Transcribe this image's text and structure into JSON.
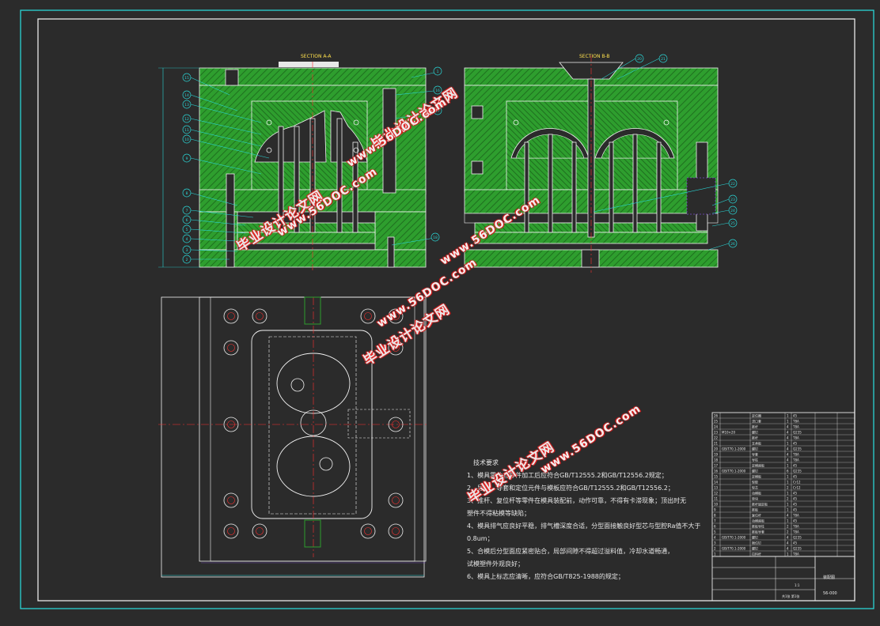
{
  "drawing": {
    "colors": {
      "background": "#2b2b2b",
      "border": "#2ad4d4",
      "green": "#2e9e2e",
      "mold_outline": "#f2f2f2",
      "section_label": "#ffe14d",
      "cyan_leader": "#2ad4d4",
      "centerline": "#ff3030",
      "watermark_red": "#e02020"
    },
    "section_a_label": "SECTION A-A",
    "section_b_label": "SECTION B-B",
    "balloons_a": [
      "15",
      "14",
      "13",
      "12",
      "11",
      "10",
      "9",
      "8",
      "7",
      "6",
      "5",
      "4",
      "3",
      "2",
      "1",
      "16",
      "17",
      "18",
      "19"
    ],
    "balloons_b": [
      "20",
      "21",
      "22",
      "23",
      "24",
      "25",
      "26"
    ]
  },
  "tech_requirements": {
    "title": "技术要求",
    "items": [
      "1、模具零件各零件加工后应符合GB/T12555.2和GB/T12556.2规定；",
      "2、导柱、导套和定位元件与模板应符合GB/T12555.2和GB/T12556.2；",
      "3、推杆、复位杆等零件在模具装配前，动作可靠，不得有卡滞现象；顶出时无",
      "    塑件不得粘模等缺陷；",
      "4、模具排气应良好平稳，排气槽深度合适，分型面接触良好型芯与型腔Ra值不大于",
      "    0.8um；",
      "5、合模后分型面应紧密贴合，局部间隙不得超过溢料值，冷却水道畅通，",
      "    试模塑件外观良好；",
      "6、模具上标志应清晰，应符合GB/T825-1988的规定；"
    ]
  },
  "watermarks": [
    {
      "text": "毕业设计论文网",
      "style": "a"
    },
    {
      "text": "www.56DOC.com",
      "style": "b"
    },
    {
      "text": "毕业设计论文网",
      "style": "a"
    },
    {
      "text": "www.56DOC.com",
      "style": "b"
    },
    {
      "text": "毕业设计论文网",
      "style": "a"
    },
    {
      "text": "www.56DOC.com",
      "style": "b"
    },
    {
      "text": "www.56DOC.com",
      "style": "b"
    },
    {
      "text": "毕业设计论文网",
      "style": "a"
    },
    {
      "text": "www.56DOC.com",
      "style": "b"
    }
  ],
  "title_block": {
    "drawing_no": "56-000",
    "drawing_name": "装配图",
    "scale": "1:1",
    "sheet": "共1张 第1张"
  },
  "bom_rows": [
    {
      "no": "26",
      "name": "定位圈",
      "qty": "1",
      "material": "45"
    },
    {
      "no": "25",
      "name": "浇口套",
      "qty": "1",
      "material": "T8A"
    },
    {
      "no": "24",
      "name": "推杆",
      "qty": "4",
      "material": "T8A"
    },
    {
      "no": "23",
      "name": "M10×20",
      "name2": "螺钉",
      "qty": "4",
      "material": "Q235"
    },
    {
      "no": "22",
      "name": "推杆",
      "qty": "4",
      "material": "T8A"
    },
    {
      "no": "21",
      "name": "支承板",
      "qty": "1",
      "material": "45"
    },
    {
      "no": "20",
      "name": "GB/T70.1-2000",
      "name2": "螺钉",
      "qty": "4",
      "material": "Q235"
    },
    {
      "no": "19",
      "name": "导套",
      "qty": "4",
      "material": "T8A"
    },
    {
      "no": "18",
      "name": "导柱",
      "qty": "4",
      "material": "T8A"
    },
    {
      "no": "17",
      "name": "定模座板",
      "qty": "1",
      "material": "45"
    },
    {
      "no": "16",
      "name": "GB/T70.1-2000",
      "name2": "螺钉",
      "qty": "6",
      "material": "Q235"
    },
    {
      "no": "15",
      "name": "定模板",
      "qty": "1",
      "material": "45"
    },
    {
      "no": "14",
      "name": "型腔",
      "qty": "1",
      "material": "Cr12"
    },
    {
      "no": "13",
      "name": "型芯",
      "qty": "2",
      "material": "Cr12"
    },
    {
      "no": "12",
      "name": "动模板",
      "qty": "1",
      "material": "45"
    },
    {
      "no": "11",
      "name": "垫块",
      "qty": "2",
      "material": "45"
    },
    {
      "no": "10",
      "name": "推杆固定板",
      "qty": "1",
      "material": "45"
    },
    {
      "no": "9",
      "name": "推板",
      "qty": "1",
      "material": "45"
    },
    {
      "no": "8",
      "name": "复位杆",
      "qty": "4",
      "material": "T8A"
    },
    {
      "no": "7",
      "name": "动模座板",
      "qty": "1",
      "material": "45"
    },
    {
      "no": "6",
      "name": "推板导柱",
      "qty": "2",
      "material": "T8A"
    },
    {
      "no": "5",
      "name": "推板导套",
      "qty": "2",
      "material": "T8A"
    },
    {
      "no": "4",
      "name": "GB/T70.1-2000",
      "name2": "螺钉",
      "qty": "4",
      "material": "Q235"
    },
    {
      "no": "3",
      "name": "限位钉",
      "qty": "4",
      "material": "45"
    },
    {
      "no": "2",
      "name": "GB/T70.1-2000",
      "name2": "螺钉",
      "qty": "4",
      "material": "Q235"
    },
    {
      "no": "1",
      "name": "拉料杆",
      "qty": "1",
      "material": "T8A"
    }
  ]
}
